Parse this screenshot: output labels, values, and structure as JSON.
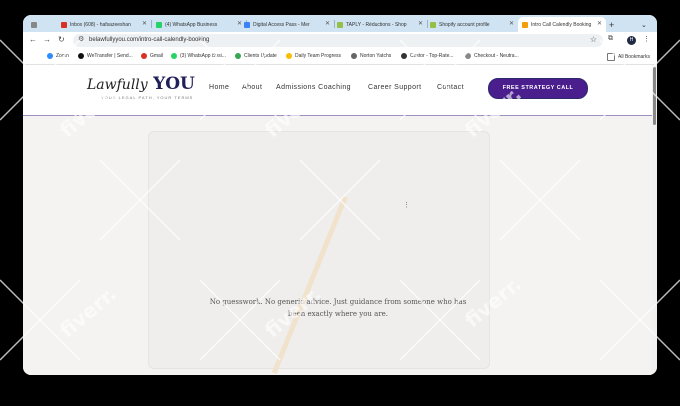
{
  "browser": {
    "tabs": [
      {
        "title": "",
        "color": "#888888"
      },
      {
        "title": "Inbox (608) - hafsazeeshan",
        "color": "#d93025"
      },
      {
        "title": "(4) WhatsApp Business",
        "color": "#25d366"
      },
      {
        "title": "Digital Access Pass - Mer",
        "color": "#3b82f6"
      },
      {
        "title": "TAPLY - Réductions - Shop",
        "color": "#95bf47"
      },
      {
        "title": "Shopify account profile",
        "color": "#95bf47"
      },
      {
        "title": "Intro Call Calendly Booking",
        "color": "#f59e0b"
      }
    ],
    "new_tab": "+",
    "url": "belawfullyyou.com/intro-call-calendly-booking",
    "profile_initial": "H",
    "bookmarks": [
      {
        "label": "Zoom",
        "color": "#2d8cff"
      },
      {
        "label": "WeTransfer | Send...",
        "color": "#111111"
      },
      {
        "label": "Gmail",
        "color": "#d93025"
      },
      {
        "label": "(3) WhatsApp Busi...",
        "color": "#25d366"
      },
      {
        "label": "Clients Update",
        "color": "#34a853"
      },
      {
        "label": "Daily Team Progress",
        "color": "#fbbc04"
      },
      {
        "label": "Norton Yatchs",
        "color": "#666666"
      },
      {
        "label": "Castor - Top-Rate...",
        "color": "#333333"
      },
      {
        "label": "Checkout - Neutra...",
        "color": "#888888"
      }
    ],
    "all_bookmarks": "All Bookmarks"
  },
  "site": {
    "logo_script": "Lawfully",
    "logo_bold": "YOU",
    "tagline": "YOUR LEGAL PATH, YOUR TERMS",
    "nav": [
      "Home",
      "About",
      "Admissions Coaching",
      "Career Support",
      "Contact"
    ],
    "cta": "FREE STRATEGY CALL",
    "hero_text_line1": "No guesswork. No generic advice. Just guidance from someone who has",
    "hero_text_line2": "been exactly where you are."
  },
  "watermark": "fiverr."
}
